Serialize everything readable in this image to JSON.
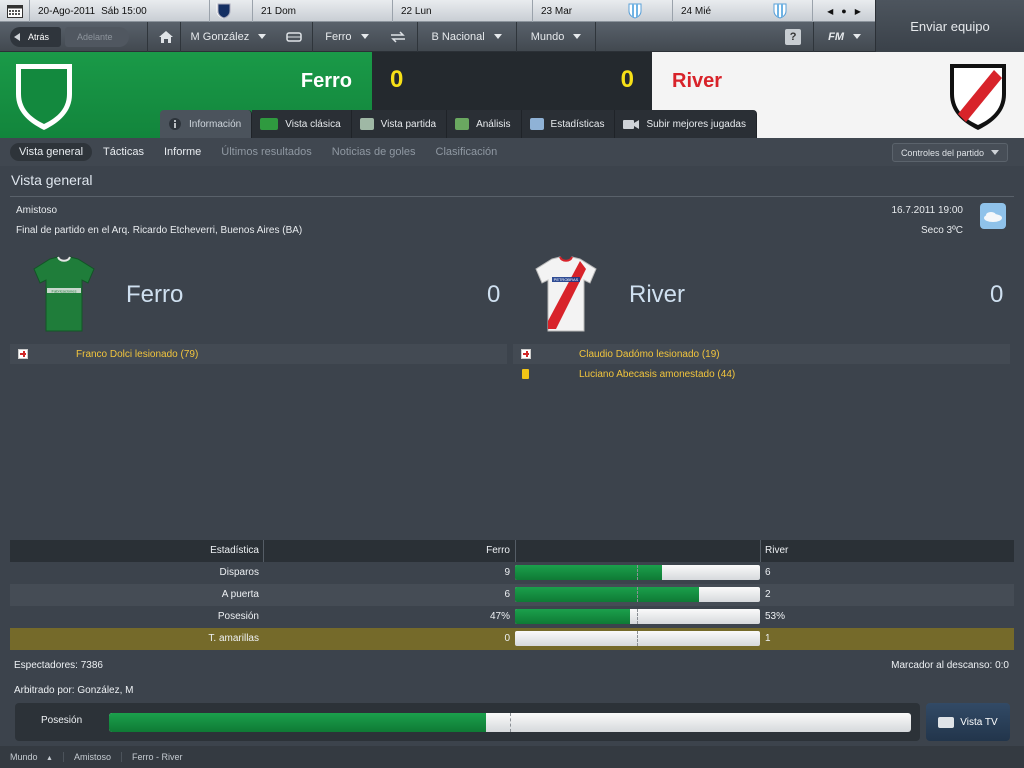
{
  "calendar": {
    "date": "20-Ago-2011",
    "day_time": "Sáb  15:00",
    "days": [
      "21 Dom",
      "22 Lun",
      "23 Mar",
      "24 Mié"
    ]
  },
  "send_button": "Enviar equipo",
  "nav": {
    "back": "Atrás",
    "forward": "Adelante",
    "manager": "M González",
    "club": "Ferro",
    "league": "B Nacional",
    "world": "Mundo",
    "help": "?",
    "fm": "FM"
  },
  "match_header": {
    "home_team": "Ferro",
    "away_team": "River",
    "home_score": "0",
    "away_score": "0"
  },
  "tabs": [
    "Información",
    "Vista clásica",
    "Vista partida",
    "Análisis",
    "Estadísticas",
    "Subir mejores jugadas"
  ],
  "subnav": {
    "items": [
      "Vista general",
      "Tácticas",
      "Informe",
      "Últimos resultados",
      "Noticias de goles",
      "Clasificación"
    ],
    "controls": "Controles del partido"
  },
  "overview": {
    "title": "Vista general",
    "competition": "Amistoso",
    "venue": "Final de partido en el Arq. Ricardo Etcheverri, Buenos Aires (BA)",
    "datetime": "16.7.2011 19:00",
    "weather": "Seco 3ºC",
    "home_name": "Ferro",
    "away_name": "River",
    "home_score": "0",
    "away_score": "0",
    "home_kit_sponsor": "Fabricaciones",
    "away_kit_sponsor": "PETROBRAS",
    "home_events": [
      {
        "type": "injury",
        "text": "Franco Dolci lesionado (79)"
      }
    ],
    "away_events": [
      {
        "type": "injury",
        "text": "Claudio Dadómo lesionado (19)"
      },
      {
        "type": "yellow",
        "text": "Luciano Abecasis amonestado (44)"
      }
    ]
  },
  "stats": {
    "header": {
      "label": "Estadística",
      "home": "Ferro",
      "away": "River"
    },
    "rows": [
      {
        "label": "Disparos",
        "home": "9",
        "away": "6",
        "home_share": 0.6
      },
      {
        "label": "A puerta",
        "home": "6",
        "away": "2",
        "home_share": 0.75
      },
      {
        "label": "Posesión",
        "home": "47%",
        "away": "53%",
        "home_share": 0.47
      },
      {
        "label": "T. amarillas",
        "home": "0",
        "away": "1",
        "home_share": 0
      }
    ]
  },
  "footer": {
    "spectators": "Espectadores: 7386",
    "halftime": "Marcador al descanso: 0:0",
    "referee": "Arbitrado por: González, M"
  },
  "possession": {
    "label": "Posesión",
    "home_share": 0.47
  },
  "tv_button": "Vista TV",
  "breadcrumbs": [
    "Mundo",
    "Amistoso",
    "Ferro - River"
  ],
  "colors": {
    "home": "#14913f",
    "away_stripe": "#d8232a",
    "score": "#f7e017",
    "event": "#f2c53d"
  }
}
